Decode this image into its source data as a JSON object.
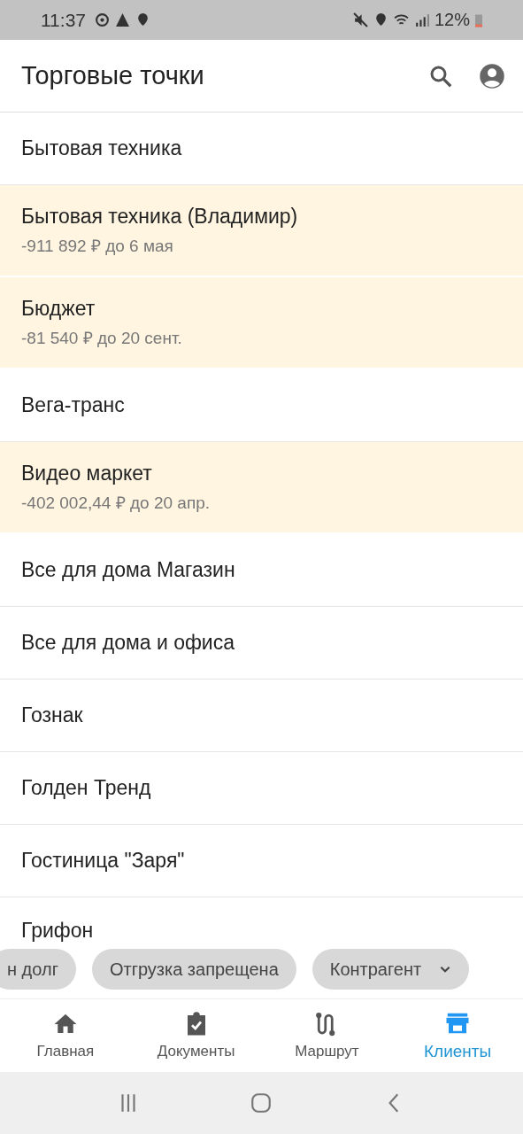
{
  "status_bar": {
    "time": "11:37",
    "battery": "12%"
  },
  "app_bar": {
    "title": "Торговые точки"
  },
  "clients": [
    {
      "name": "Бытовая техника",
      "overdue": false
    },
    {
      "name": "Бытовая техника (Владимир)",
      "debt": "-911 892 ₽ до 6 мая",
      "overdue": true
    },
    {
      "name": "Бюджет",
      "debt": "-81 540 ₽ до 20 сент.",
      "overdue": true
    },
    {
      "name": "Вега-транс",
      "overdue": false
    },
    {
      "name": "Видео маркет",
      "debt": "-402 002,44 ₽ до 20 апр.",
      "overdue": true
    },
    {
      "name": "Все для дома Магазин",
      "overdue": false
    },
    {
      "name": "Все для дома и офиса",
      "overdue": false
    },
    {
      "name": "Гознак",
      "overdue": false
    },
    {
      "name": "Голден Тренд",
      "overdue": false
    },
    {
      "name": "Гостиница \"Заря\"",
      "overdue": false
    },
    {
      "name": "Грифон",
      "overdue": false
    }
  ],
  "filters": [
    {
      "label": "н долг",
      "kind": "chip"
    },
    {
      "label": "Отгрузка запрещена",
      "kind": "chip"
    },
    {
      "label": "Контрагент",
      "kind": "dropdown"
    }
  ],
  "bottom_nav": [
    {
      "label": "Главная",
      "kind": "home",
      "selected": false
    },
    {
      "label": "Документы",
      "kind": "docs",
      "selected": false
    },
    {
      "label": "Маршрут",
      "kind": "route",
      "selected": false
    },
    {
      "label": "Клиенты",
      "kind": "store",
      "selected": true
    }
  ]
}
